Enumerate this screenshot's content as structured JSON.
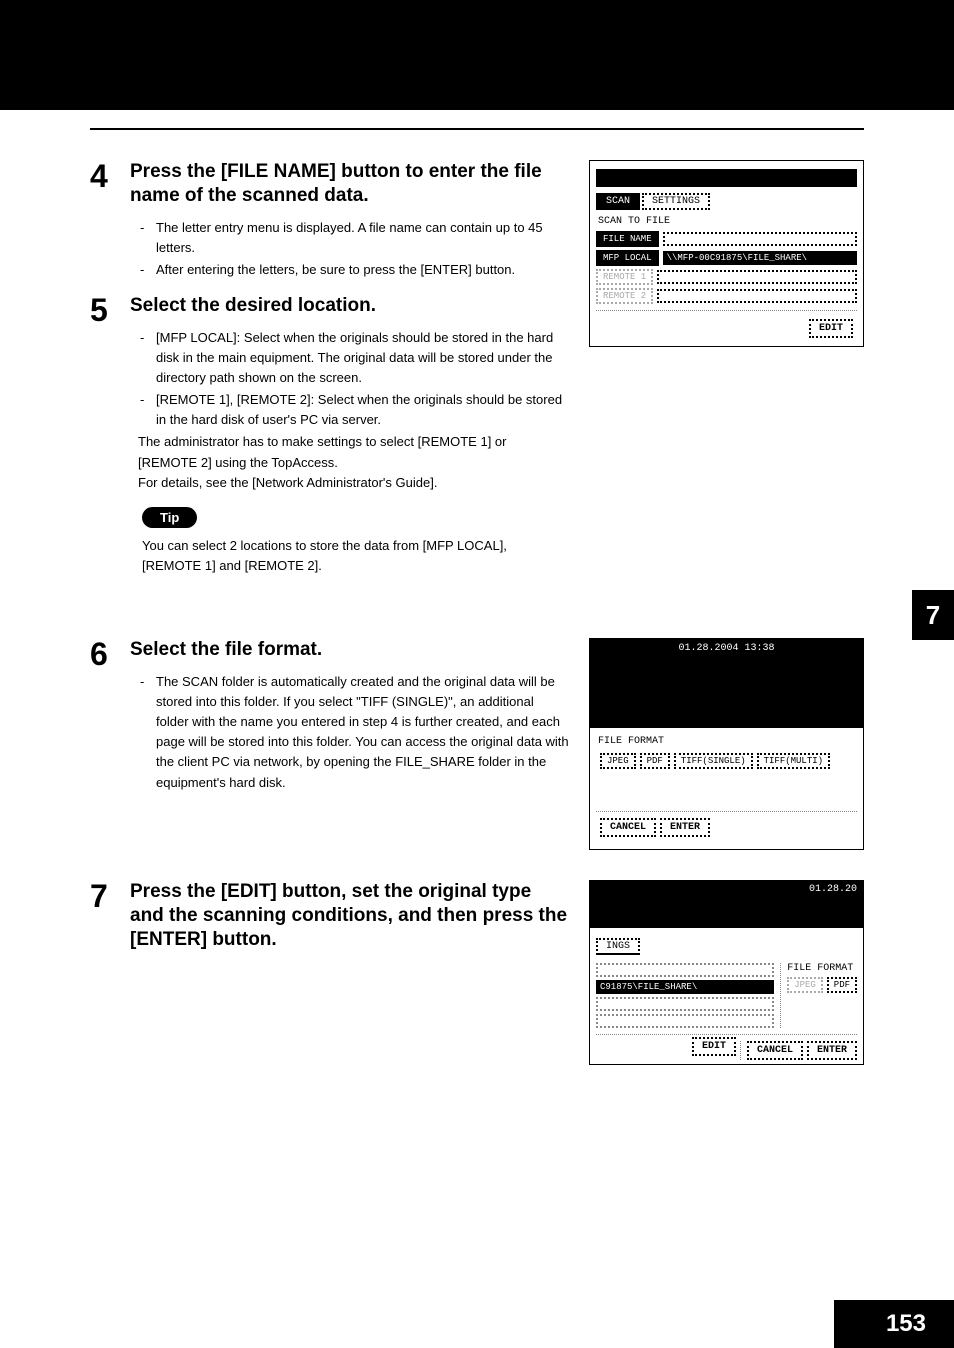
{
  "chapter_number": "7",
  "page_number": "153",
  "steps": {
    "s4": {
      "num": "4",
      "title": "Press the [FILE NAME] button to enter the file name of the scanned data.",
      "bullets": [
        "The letter entry menu is displayed. A file name can contain up to 45 letters.",
        "After entering the letters, be sure to press the [ENTER] button."
      ]
    },
    "s5": {
      "num": "5",
      "title": "Select the desired location.",
      "bullets": [
        "[MFP LOCAL]: Select when the originals should be stored in the hard disk in the main equipment. The original data will be stored under the directory path shown on the screen.",
        "[REMOTE 1], [REMOTE 2]: Select when the originals should be stored in the hard disk of user's PC via server."
      ],
      "sub": [
        "The administrator has to make settings to select [REMOTE 1] or [REMOTE 2] using the TopAccess.",
        "For details, see the [Network Administrator's Guide]."
      ],
      "tip_label": "Tip",
      "tip_text": "You can select 2 locations to store the data from [MFP LOCAL], [REMOTE 1] and [REMOTE 2]."
    },
    "s6": {
      "num": "6",
      "title": "Select the file format.",
      "bullets": [
        "The SCAN folder is automatically created and the original data will be stored into this folder. If you select \"TIFF (SINGLE)\", an additional folder with the name you entered in step 4 is further created, and each page will be stored into this folder. You can access the original data with the client PC via network, by opening the FILE_SHARE folder in the equipment's hard disk."
      ]
    },
    "s7": {
      "num": "7",
      "title": "Press the [EDIT] button, set the original type and the scanning conditions, and then press the [ENTER] button."
    }
  },
  "screens": {
    "scan_settings": {
      "tab_scan": "SCAN",
      "tab_settings": "SETTINGS",
      "heading": "SCAN TO FILE",
      "filename_btn": "FILE NAME",
      "mfplocal_btn": "MFP LOCAL",
      "path": "\\\\MFP-00C91875\\FILE_SHARE\\",
      "remote1_btn": "REMOTE 1",
      "remote2_btn": "REMOTE 2",
      "edit_btn": "EDIT"
    },
    "file_format": {
      "datetime": "01.28.2004 13:38",
      "label": "FILE FORMAT",
      "jpeg": "JPEG",
      "pdf": "PDF",
      "tiff_s": "TIFF(SINGLE)",
      "tiff_m": "TIFF(MULTI)",
      "cancel": "CANCEL",
      "enter": "ENTER"
    },
    "edit": {
      "datetime": "01.28.20",
      "ings": "INGS",
      "path_frag": "C91875\\FILE_SHARE\\",
      "ff_label": "FILE FORMAT",
      "jpeg": "JPEG",
      "pdf": "PDF",
      "edit_btn": "EDIT",
      "cancel": "CANCEL",
      "enter": "ENTER"
    }
  }
}
